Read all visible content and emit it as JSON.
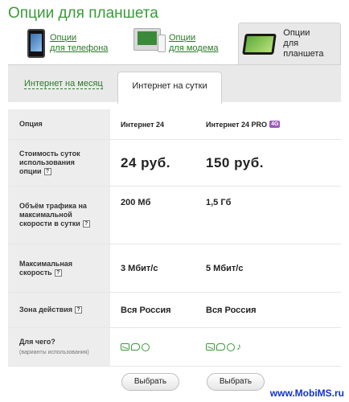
{
  "page": {
    "title": "Опции для планшета"
  },
  "category_tabs": [
    {
      "line1": "Опции",
      "line2": "для телефона",
      "icon": "phone-icon",
      "active": false
    },
    {
      "line1": "Опции",
      "line2": "для модема",
      "icon": "modem-icon",
      "active": false
    },
    {
      "line1": "Опции",
      "line2": "для планшета",
      "icon": "tablet-icon",
      "active": true
    }
  ],
  "period_tabs": [
    {
      "label": "Интернет на месяц",
      "active": false
    },
    {
      "label": "Интернет на сутки",
      "active": true
    }
  ],
  "table": {
    "header": {
      "label": "Опция",
      "plan1": "Интернет 24",
      "plan2": "Интернет 24 PRO",
      "plan2_badge": "4G"
    },
    "rows": [
      {
        "label_lines": [
          "Стоимость суток",
          "использования",
          "опции"
        ],
        "has_help": true,
        "plan1": "24 руб.",
        "plan2": "150 руб."
      },
      {
        "label_lines": [
          "Объём трафика на",
          "максимальной",
          "скорости в сутки"
        ],
        "has_help": true,
        "plan1": "200 Мб",
        "plan2": "1,5 Гб"
      },
      {
        "label_lines": [
          "Максимальная",
          "скорость"
        ],
        "has_help": true,
        "plan1": "3 Мбит/с",
        "plan2": "5 Мбит/с"
      },
      {
        "label_lines": [
          "Зона действия"
        ],
        "has_help": true,
        "plan1": "Вся Россия",
        "plan2": "Вся Россия"
      }
    ],
    "usage_row": {
      "label": "Для чего?",
      "note": "(варианты использования)",
      "plan1_icons": [
        "envelope-icon",
        "chat-icon",
        "globe-icon"
      ],
      "plan2_icons": [
        "envelope-icon",
        "chat-icon",
        "globe-icon",
        "music-note-icon"
      ]
    },
    "help_symbol": "?",
    "choose_label": "Выбрать"
  },
  "watermark": "www.MobiMS.ru",
  "colors": {
    "brand_green": "#3a9a3a",
    "badge_purple": "#9c59b6",
    "watermark_blue": "#1133cc"
  }
}
